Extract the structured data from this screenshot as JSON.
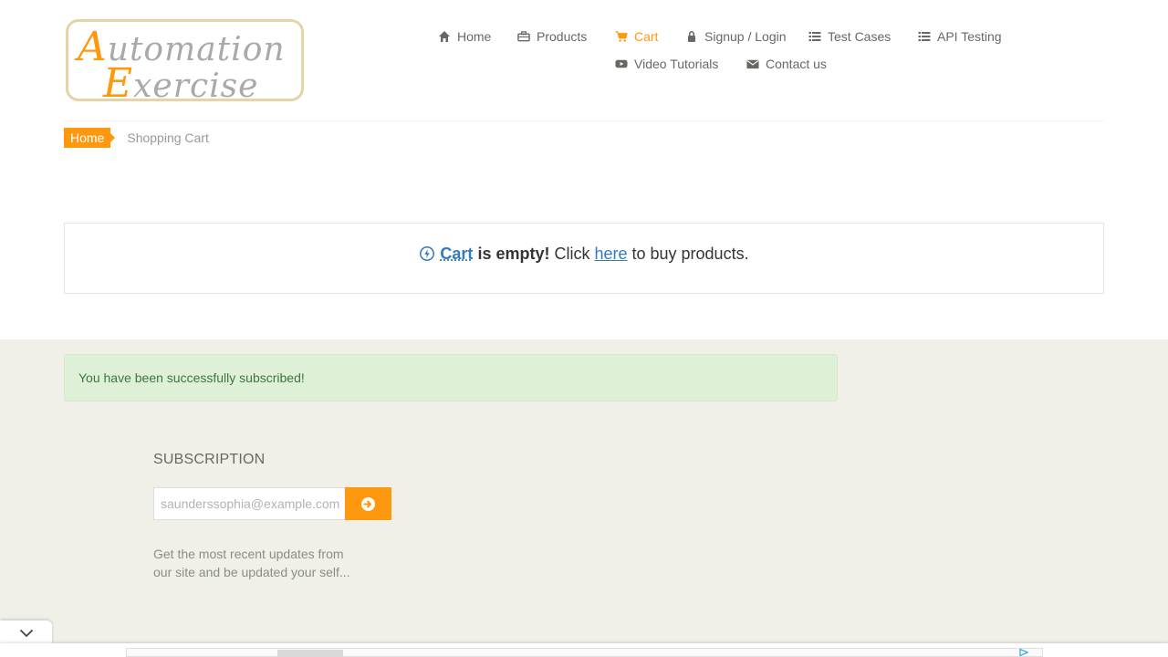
{
  "logo": {
    "line1_cap": "A",
    "line1_rest": "utomation",
    "line2_cap": "E",
    "line2_rest": "xercise"
  },
  "nav": {
    "home": "Home",
    "products": "Products",
    "cart": "Cart",
    "signup": "Signup / Login",
    "test_cases": "Test Cases",
    "api_testing": "API Testing",
    "video_tutorials": "Video Tutorials",
    "contact": "Contact us"
  },
  "breadcrumb": {
    "home": "Home",
    "current": "Shopping Cart"
  },
  "empty_cart": {
    "cart_link": "Cart",
    "is_empty": "is empty!",
    "click": "Click",
    "here_link": "here",
    "tail": "to buy products."
  },
  "footer": {
    "alert": "You have been successfully subscribed!",
    "subscription_title": "SUBSCRIPTION",
    "email_value": "saunderssophia@example.com",
    "description": "Get the most recent updates from our site and be updated your self..."
  },
  "colors": {
    "accent": "#fe980f",
    "link": "#337ab7",
    "footer_bg": "#f0f0e9",
    "alert_bg": "#dff0d8",
    "alert_text": "#3c763d"
  }
}
